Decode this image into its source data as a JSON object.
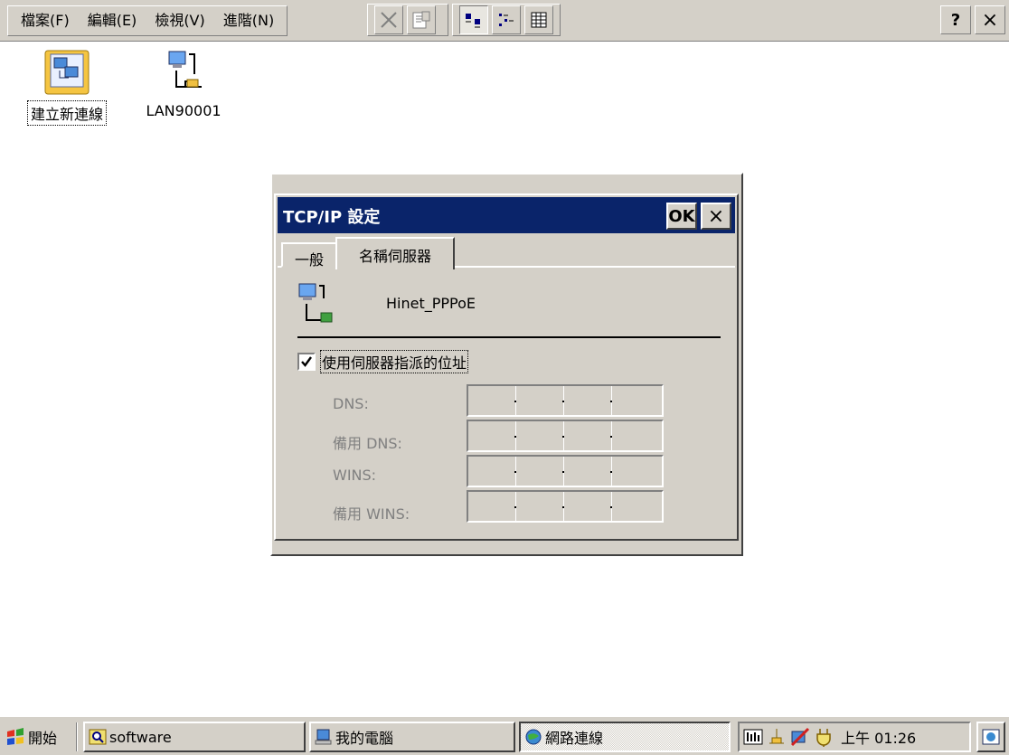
{
  "menubar": {
    "menus": [
      "檔案(F)",
      "編輯(E)",
      "檢視(V)",
      "進階(N)"
    ],
    "help_label": "?",
    "close_label": "×"
  },
  "desktop": {
    "icons": [
      {
        "label": "建立新連線"
      },
      {
        "label": "LAN90001"
      }
    ]
  },
  "dialog": {
    "title": "TCP/IP 設定",
    "ok_label": "OK",
    "close_label": "×",
    "tabs": [
      "一般",
      "名稱伺服器"
    ],
    "connection_name": "Hinet_PPPoE",
    "use_server_checkbox": {
      "label": "使用伺服器指派的位址",
      "checked": true
    },
    "fields": [
      {
        "label": "DNS:",
        "value": ""
      },
      {
        "label": "備用 DNS:",
        "value": ""
      },
      {
        "label": "WINS:",
        "value": ""
      },
      {
        "label": "備用 WINS:",
        "value": ""
      }
    ]
  },
  "taskbar": {
    "start_label": "開始",
    "tasks": [
      {
        "label": "software",
        "icon": "search-folder-icon"
      },
      {
        "label": "我的電腦",
        "icon": "my-computer-icon"
      },
      {
        "label": "網路連線",
        "icon": "network-connections-icon",
        "active": true
      }
    ],
    "clock": "上午 01:26"
  },
  "colors": {
    "titlebar": "#0a246a",
    "face": "#d4d0c8",
    "desktop": "#ffffff"
  }
}
